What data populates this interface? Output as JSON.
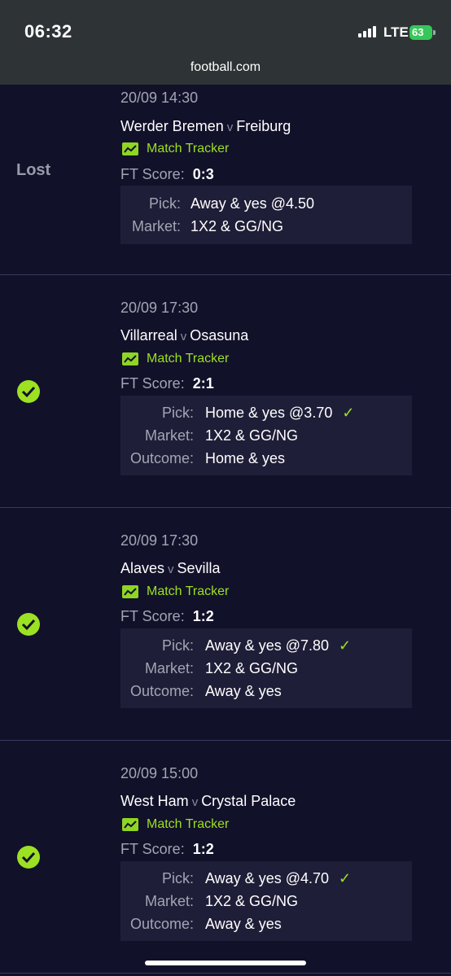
{
  "status_bar": {
    "time": "06:32",
    "network": "LTE",
    "battery": "63"
  },
  "browser": {
    "url": "football.com"
  },
  "bets": [
    {
      "status_text": "Lost",
      "datetime": "20/09 14:30",
      "home": "Werder Bremen",
      "vs": "v",
      "away": "Freiburg",
      "tracker_label": "Match Tracker",
      "score_label": "FT Score:",
      "score": "0:3",
      "pick_label": "Pick:",
      "pick": "Away & yes @4.50",
      "market_label": "Market:",
      "market": "1X2 & GG/NG"
    },
    {
      "status_icon": "check-icon",
      "datetime": "20/09 17:30",
      "home": "Villarreal",
      "vs": "v",
      "away": "Osasuna",
      "tracker_label": "Match Tracker",
      "score_label": "FT Score:",
      "score": "2:1",
      "pick_label": "Pick:",
      "pick": "Home & yes @3.70",
      "market_label": "Market:",
      "market": "1X2 & GG/NG",
      "outcome_label": "Outcome:",
      "outcome": "Home & yes"
    },
    {
      "status_icon": "check-icon",
      "datetime": "20/09 17:30",
      "home": "Alaves",
      "vs": "v",
      "away": "Sevilla",
      "tracker_label": "Match Tracker",
      "score_label": "FT Score:",
      "score": "1:2",
      "pick_label": "Pick:",
      "pick": "Away & yes @7.80",
      "market_label": "Market:",
      "market": "1X2 & GG/NG",
      "outcome_label": "Outcome:",
      "outcome": "Away & yes"
    },
    {
      "status_icon": "check-icon",
      "datetime": "20/09 15:00",
      "home": "West Ham",
      "vs": "v",
      "away": "Crystal Palace",
      "tracker_label": "Match Tracker",
      "score_label": "FT Score:",
      "score": "1:2",
      "pick_label": "Pick:",
      "pick": "Away & yes @4.70",
      "market_label": "Market:",
      "market": "1X2 & GG/NG",
      "outcome_label": "Outcome:",
      "outcome": "Away & yes"
    }
  ],
  "colors": {
    "background": "#12112a",
    "accent": "#9be022",
    "panel": "#1f1e38",
    "muted": "#a4a4b4"
  }
}
